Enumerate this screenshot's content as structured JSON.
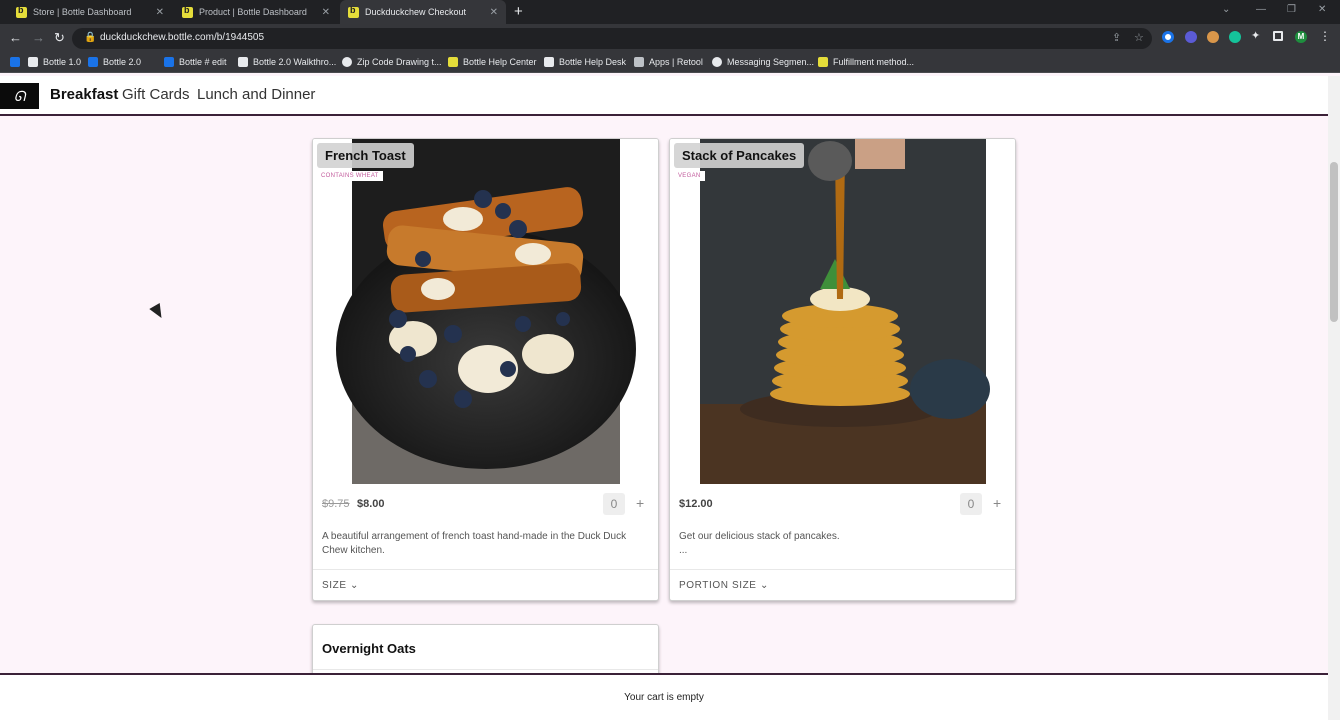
{
  "browser": {
    "tabs": [
      {
        "title": "Store | Bottle Dashboard"
      },
      {
        "title": "Product | Bottle Dashboard"
      },
      {
        "title": "Duckduckchew Checkout"
      }
    ],
    "url": "duckduckchew.bottle.com/b/1944505",
    "bookmarks": [
      {
        "label": "Bottle 1.0"
      },
      {
        "label": "Bottle 2.0"
      },
      {
        "label": "Bottle # edit"
      },
      {
        "label": "Bottle 2.0 Walkthro..."
      },
      {
        "label": "Zip Code Drawing t..."
      },
      {
        "label": "Bottle Help Center"
      },
      {
        "label": "Bottle Help Desk"
      },
      {
        "label": "Apps | Retool"
      },
      {
        "label": "Messaging Segmen..."
      },
      {
        "label": "Fulfillment method..."
      }
    ],
    "profile_initial": "M"
  },
  "nav": {
    "items": [
      {
        "label": "Breakfast"
      },
      {
        "label": "Gift Cards"
      },
      {
        "label": "Lunch and Dinner"
      }
    ]
  },
  "products": [
    {
      "title": "French Toast",
      "tag": "CONTAINS WHEAT",
      "old_price": "$9.75",
      "price": "$8.00",
      "quantity": "0",
      "description": "A beautiful arrangement of french toast hand-made in the Duck Duck Chew kitchen.",
      "option": "SIZE"
    },
    {
      "title": "Stack of Pancakes",
      "tag": "VEGAN",
      "price": "$12.00",
      "quantity": "0",
      "description": "Get our delicious stack of pancakes.\n...",
      "option": "PORTION SIZE"
    },
    {
      "title": "Overnight Oats"
    }
  ],
  "cart": {
    "message": "Your cart is empty"
  },
  "colors": {
    "accent": "#3b2138",
    "background": "#fdf4fa",
    "tag": "#c25b9c"
  }
}
